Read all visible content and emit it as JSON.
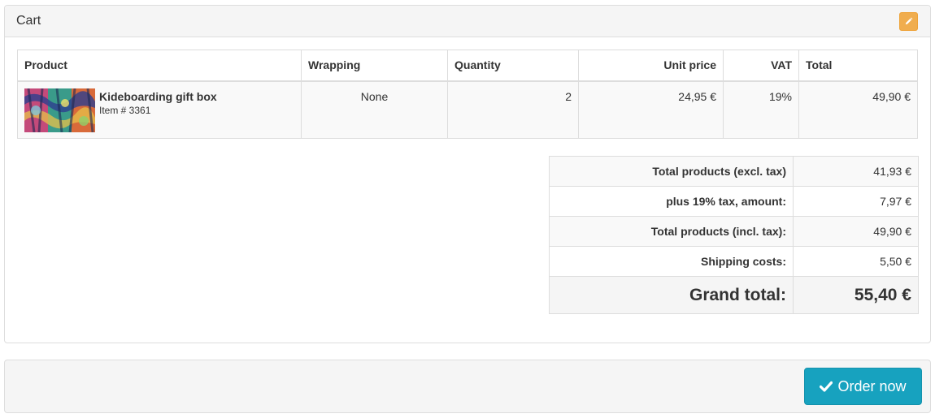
{
  "cart": {
    "title": "Cart",
    "columns": {
      "product": "Product",
      "wrapping": "Wrapping",
      "quantity": "Quantity",
      "unit_price": "Unit price",
      "vat": "VAT",
      "total": "Total"
    },
    "items": [
      {
        "name": "Kideboarding gift box",
        "sku": "Item # 3361",
        "wrapping": "None",
        "quantity": "2",
        "unit_price": "24,95 €",
        "vat": "19%",
        "total": "49,90 €"
      }
    ],
    "totals": {
      "excl_tax_label": "Total products (excl. tax)",
      "excl_tax_value": "41,93 €",
      "tax_label": "plus 19% tax, amount:",
      "tax_value": "7,97 €",
      "incl_tax_label": "Total products (incl. tax):",
      "incl_tax_value": "49,90 €",
      "shipping_label": "Shipping costs:",
      "shipping_value": "5,50 €",
      "grand_label": "Grand total:",
      "grand_value": "55,40 €"
    }
  },
  "actions": {
    "order_label": "Order now",
    "order_icon": "check-icon",
    "edit_icon": "pencil-icon"
  },
  "colors": {
    "edit_button": "#f0ad4e",
    "order_button": "#17a2bf"
  }
}
